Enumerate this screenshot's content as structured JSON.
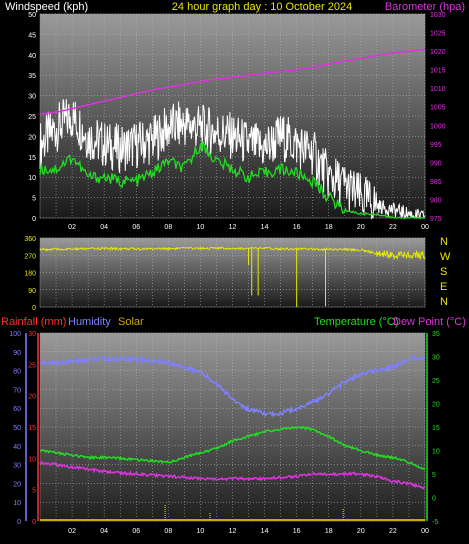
{
  "header": {
    "windspeed_label": "Windspeed (kph)",
    "title": "24 hour graph day : 10 October 2024",
    "barometer_label": "Barometer (hpa)"
  },
  "lower_labels": {
    "rainfall": "Rainfall (mm)",
    "humidity": "Humidity",
    "solar": "Solar",
    "temperature": "Temperature (°C)",
    "dewpoint": "Dew Point (°C)"
  },
  "compass": [
    "N",
    "W",
    "S",
    "E",
    "N"
  ],
  "colors": {
    "wind_gust": "#ffffff",
    "wind_avg": "#22dd22",
    "barometer": "#dd33dd",
    "direction": "#e8e800",
    "rainfall": "#ff3030",
    "humidity": "#8080ff",
    "solar": "#e8e800",
    "temperature": "#22dd22",
    "dewpoint": "#dd33dd",
    "windspeed_label": "#ffffff",
    "title": "#e8e800",
    "barometer_label": "#dd33dd"
  },
  "chart_data": [
    {
      "type": "line",
      "x_ticks": [
        "02",
        "04",
        "06",
        "08",
        "10",
        "12",
        "14",
        "16",
        "18",
        "20",
        "22",
        "00"
      ],
      "x_hours": [
        1,
        24
      ],
      "left_axis": {
        "label": "Windspeed (kph)",
        "ticks": [
          0,
          5,
          10,
          15,
          20,
          25,
          30,
          35,
          40,
          45,
          50
        ],
        "ylim": [
          0,
          50
        ]
      },
      "right_axis": {
        "label": "Barometer (hpa)",
        "ticks": [
          975,
          980,
          985,
          990,
          995,
          1000,
          1005,
          1010,
          1015,
          1020,
          1025,
          1030
        ],
        "ylim": [
          975,
          1030
        ]
      },
      "series": [
        {
          "name": "Gust",
          "axis": "left",
          "x": [
            0,
            1,
            2,
            3,
            4,
            5,
            6,
            7,
            8,
            9,
            10,
            11,
            12,
            13,
            14,
            15,
            16,
            17,
            18,
            19,
            20,
            21,
            22,
            23,
            24
          ],
          "values": [
            18,
            22,
            25,
            20,
            18,
            17,
            18,
            19,
            22,
            23,
            22,
            21,
            20,
            18,
            17,
            20,
            18,
            16,
            10,
            8,
            5,
            3,
            2,
            1,
            0
          ]
        },
        {
          "name": "Average",
          "axis": "left",
          "x": [
            0,
            1,
            2,
            3,
            4,
            5,
            6,
            7,
            8,
            9,
            10,
            11,
            12,
            13,
            14,
            15,
            16,
            17,
            18,
            19,
            20,
            21,
            22,
            23,
            24
          ],
          "values": [
            12,
            12,
            15,
            10,
            10,
            9,
            9,
            11,
            14,
            12,
            18,
            14,
            12,
            10,
            11,
            12,
            11,
            9,
            5,
            2,
            1,
            1,
            0,
            0,
            0
          ]
        },
        {
          "name": "Barometer",
          "axis": "right",
          "x": [
            0,
            1,
            2,
            3,
            4,
            5,
            6,
            7,
            8,
            9,
            10,
            11,
            12,
            13,
            14,
            15,
            16,
            17,
            18,
            19,
            20,
            21,
            22,
            23,
            24
          ],
          "values": [
            1003,
            1003.5,
            1004.5,
            1005.5,
            1006.5,
            1007.5,
            1008.5,
            1009.5,
            1010.3,
            1011,
            1011.8,
            1012.5,
            1013,
            1013.5,
            1014,
            1014.5,
            1015,
            1015.5,
            1016.5,
            1017.3,
            1018,
            1018.8,
            1019.5,
            1020,
            1020.5
          ]
        }
      ],
      "grid": true
    },
    {
      "type": "scatter",
      "x_hours": [
        1,
        24
      ],
      "y_axis": {
        "ticks": [
          0,
          90,
          180,
          270,
          360
        ],
        "ylim": [
          0,
          360
        ]
      },
      "series": [
        {
          "name": "Wind Direction",
          "x": [
            0,
            2,
            4,
            6,
            8,
            10,
            12,
            13,
            14,
            15,
            16,
            17,
            18,
            19,
            20,
            21,
            22,
            23,
            24
          ],
          "values": [
            300,
            302,
            305,
            303,
            305,
            307,
            306,
            305,
            306,
            304,
            303,
            302,
            302,
            300,
            298,
            280,
            270,
            268,
            272
          ]
        }
      ],
      "spikes": [
        {
          "x": 16,
          "value": 0
        },
        {
          "x": 17.8,
          "value": 5
        },
        {
          "x": 13.2,
          "value": 60
        },
        {
          "x": 13.6,
          "value": 60
        },
        {
          "x": 13.0,
          "value": 220
        }
      ],
      "grid": true
    },
    {
      "type": "line",
      "x_ticks": [
        "02",
        "04",
        "06",
        "08",
        "10",
        "12",
        "14",
        "16",
        "18",
        "20",
        "22",
        "00"
      ],
      "x_hours": [
        1,
        24
      ],
      "rain_axis": {
        "ticks": [
          0,
          5,
          10,
          15,
          20,
          25,
          30
        ],
        "ylim": [
          0,
          30
        ]
      },
      "humidity_axis": {
        "ticks": [
          0,
          10,
          20,
          30,
          40,
          50,
          60,
          70,
          80,
          90,
          100
        ],
        "ylim": [
          0,
          100
        ]
      },
      "temp_axis": {
        "ticks": [
          -5,
          0,
          5,
          10,
          15,
          20,
          25,
          30,
          35
        ],
        "ylim": [
          -5,
          35
        ]
      },
      "series": [
        {
          "name": "Humidity",
          "axis": "humidity",
          "x": [
            0,
            1,
            2,
            3,
            4,
            5,
            6,
            7,
            8,
            9,
            10,
            11,
            12,
            13,
            14,
            15,
            16,
            17,
            18,
            19,
            20,
            21,
            22,
            23,
            24
          ],
          "values": [
            84,
            84,
            85,
            86,
            86,
            86,
            86,
            85,
            84,
            82,
            79,
            73,
            65,
            59,
            57,
            57,
            60,
            63,
            68,
            74,
            78,
            80,
            82,
            86,
            87
          ]
        },
        {
          "name": "Temperature",
          "axis": "temp",
          "x": [
            0,
            1,
            2,
            3,
            4,
            5,
            6,
            7,
            8,
            9,
            10,
            11,
            12,
            13,
            14,
            15,
            16,
            17,
            18,
            19,
            20,
            21,
            22,
            23,
            24
          ],
          "values": [
            10,
            9.5,
            9,
            8.5,
            8.5,
            8.3,
            8,
            7.8,
            7.5,
            8.5,
            9.5,
            10.5,
            12,
            13,
            14,
            14.5,
            15,
            14.5,
            13,
            11,
            10,
            9,
            8.5,
            7.5,
            6
          ]
        },
        {
          "name": "Dew Point",
          "axis": "temp",
          "x": [
            0,
            1,
            2,
            3,
            4,
            5,
            6,
            7,
            8,
            9,
            10,
            11,
            12,
            13,
            14,
            15,
            16,
            17,
            18,
            19,
            20,
            21,
            22,
            23,
            24
          ],
          "values": [
            7.5,
            7,
            6.5,
            6,
            5.5,
            5.2,
            5,
            4.8,
            4.5,
            4.3,
            4,
            4,
            4,
            4,
            4,
            4.2,
            4.5,
            5,
            5,
            5,
            5,
            4.5,
            3.5,
            3,
            2
          ]
        },
        {
          "name": "Rainfall",
          "axis": "rain",
          "x": [
            0,
            24
          ],
          "values": [
            0,
            0
          ]
        },
        {
          "name": "Solar",
          "axis": "humidity",
          "x": [
            4.2,
            7.8,
            10.6,
            18.9
          ],
          "values": [
            1,
            8,
            4,
            6
          ]
        }
      ],
      "grid": true
    }
  ]
}
